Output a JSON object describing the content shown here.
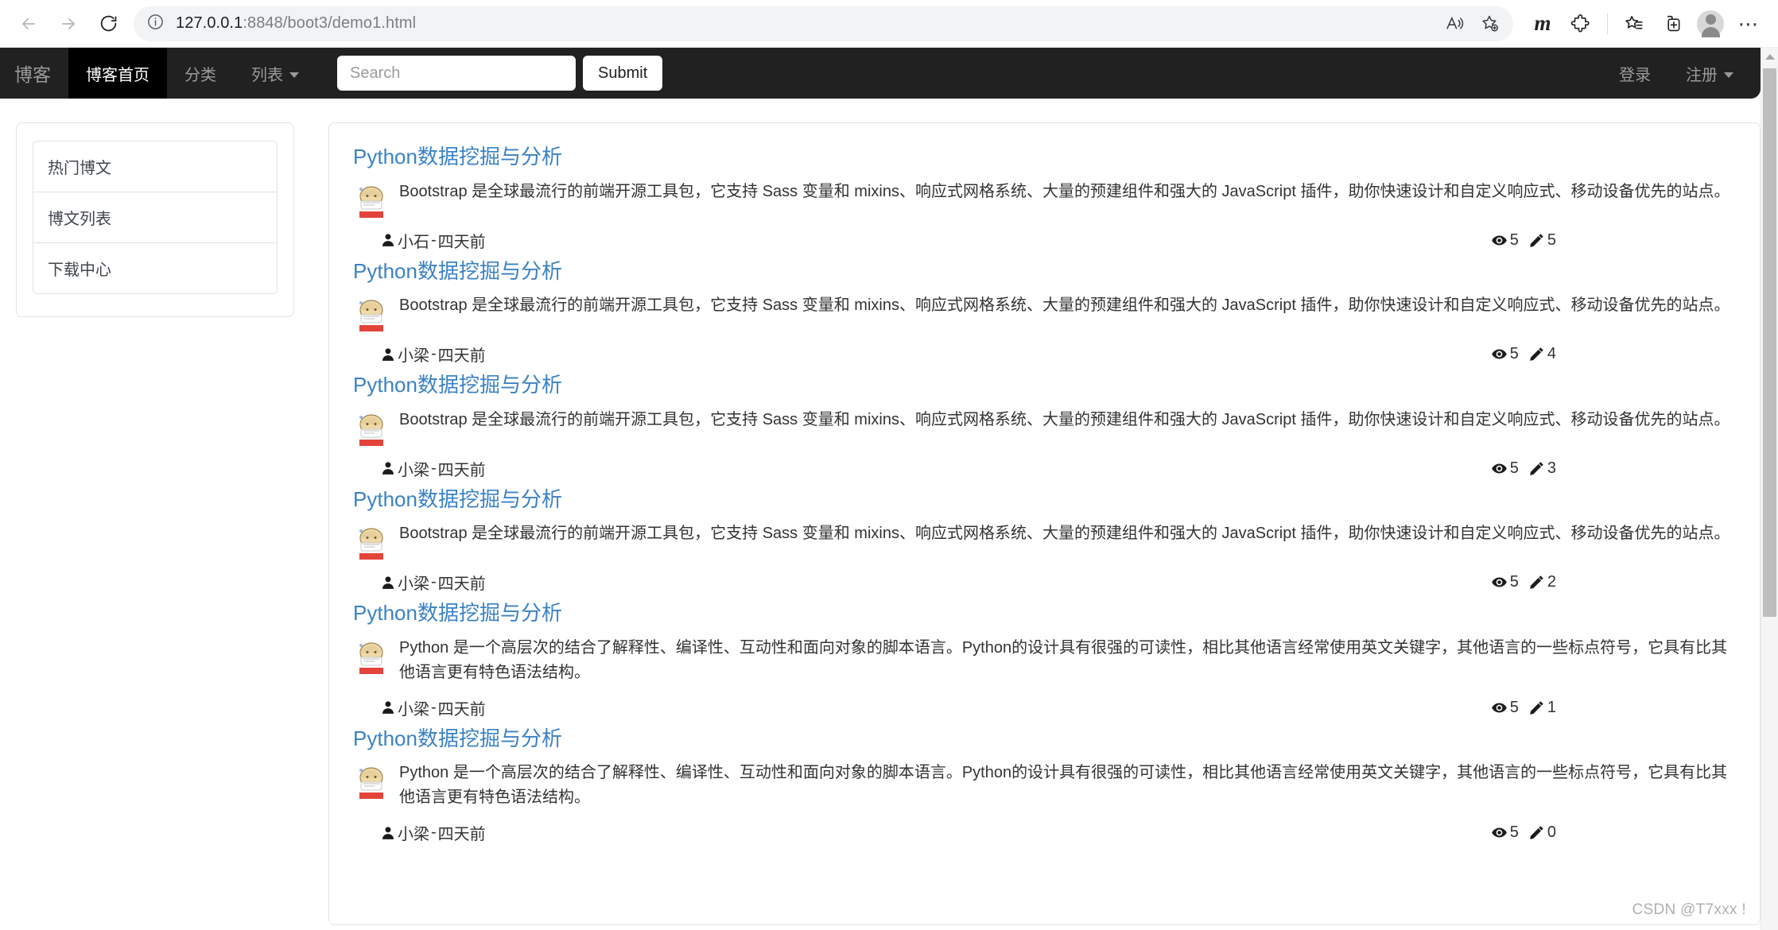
{
  "browser": {
    "back_label": "back-navigation",
    "forward_label": "forward-navigation",
    "reload_label": "reload-page",
    "url_main": "127.0.0.1",
    "url_rest": ":8848/boot3/demo1.html",
    "read_aloud_label": "read-aloud",
    "add_favorite_label": "add-to-favorites",
    "m_label": "m",
    "extensions_label": "extensions",
    "collections_label": "collections",
    "split_screen_label": "browser-essentials",
    "profile_label": "profile",
    "settings_label": "settings-and-more"
  },
  "navbar": {
    "brand": "博客",
    "links": [
      {
        "label": "博客首页",
        "active": true,
        "dropdown": false
      },
      {
        "label": "分类",
        "active": false,
        "dropdown": false
      },
      {
        "label": "列表",
        "active": false,
        "dropdown": true
      }
    ],
    "search_placeholder": "Search",
    "search_value": "",
    "submit_label": "Submit",
    "right_links": [
      {
        "label": "登录",
        "dropdown": false
      },
      {
        "label": "注册",
        "dropdown": true
      }
    ]
  },
  "sidebar": {
    "items": [
      {
        "label": "热门博文"
      },
      {
        "label": "博文列表"
      },
      {
        "label": "下载中心"
      }
    ]
  },
  "posts": [
    {
      "title": "Python数据挖掘与分析",
      "excerpt": "Bootstrap 是全球最流行的前端开源工具包，它支持 Sass 变量和 mixins、响应式网格系统、大量的预建组件和强大的 JavaScript 插件，助你快速设计和自定义响应式、移动设备优先的站点。",
      "author": "小石",
      "time": "四天前",
      "views": "5",
      "edits": "5"
    },
    {
      "title": "Python数据挖掘与分析",
      "excerpt": "Bootstrap 是全球最流行的前端开源工具包，它支持 Sass 变量和 mixins、响应式网格系统、大量的预建组件和强大的 JavaScript 插件，助你快速设计和自定义响应式、移动设备优先的站点。",
      "author": "小梁",
      "time": "四天前",
      "views": "5",
      "edits": "4"
    },
    {
      "title": "Python数据挖掘与分析",
      "excerpt": "Bootstrap 是全球最流行的前端开源工具包，它支持 Sass 变量和 mixins、响应式网格系统、大量的预建组件和强大的 JavaScript 插件，助你快速设计和自定义响应式、移动设备优先的站点。",
      "author": "小梁",
      "time": "四天前",
      "views": "5",
      "edits": "3"
    },
    {
      "title": "Python数据挖掘与分析",
      "excerpt": "Bootstrap 是全球最流行的前端开源工具包，它支持 Sass 变量和 mixins、响应式网格系统、大量的预建组件和强大的 JavaScript 插件，助你快速设计和自定义响应式、移动设备优先的站点。",
      "author": "小梁",
      "time": "四天前",
      "views": "5",
      "edits": "2"
    },
    {
      "title": "Python数据挖掘与分析",
      "excerpt": "Python 是一个高层次的结合了解释性、编译性、互动性和面向对象的脚本语言。Python的设计具有很强的可读性，相比其他语言经常使用英文关键字，其他语言的一些标点符号，它具有比其他语言更有特色语法结构。",
      "author": "小梁",
      "time": "四天前",
      "views": "5",
      "edits": "1"
    },
    {
      "title": "Python数据挖掘与分析",
      "excerpt": "Python 是一个高层次的结合了解释性、编译性、互动性和面向对象的脚本语言。Python的设计具有很强的可读性，相比其他语言经常使用英文关键字，其他语言的一些标点符号，它具有比其他语言更有特色语法结构。",
      "author": "小梁",
      "time": "四天前",
      "views": "5",
      "edits": "0"
    }
  ],
  "watermark": "CSDN @T7xxx !",
  "colors": {
    "navbar_bg": "#212121",
    "navbar_active_bg": "#000000",
    "link_blue": "#3b82c4",
    "muted": "#9a9a9a"
  }
}
